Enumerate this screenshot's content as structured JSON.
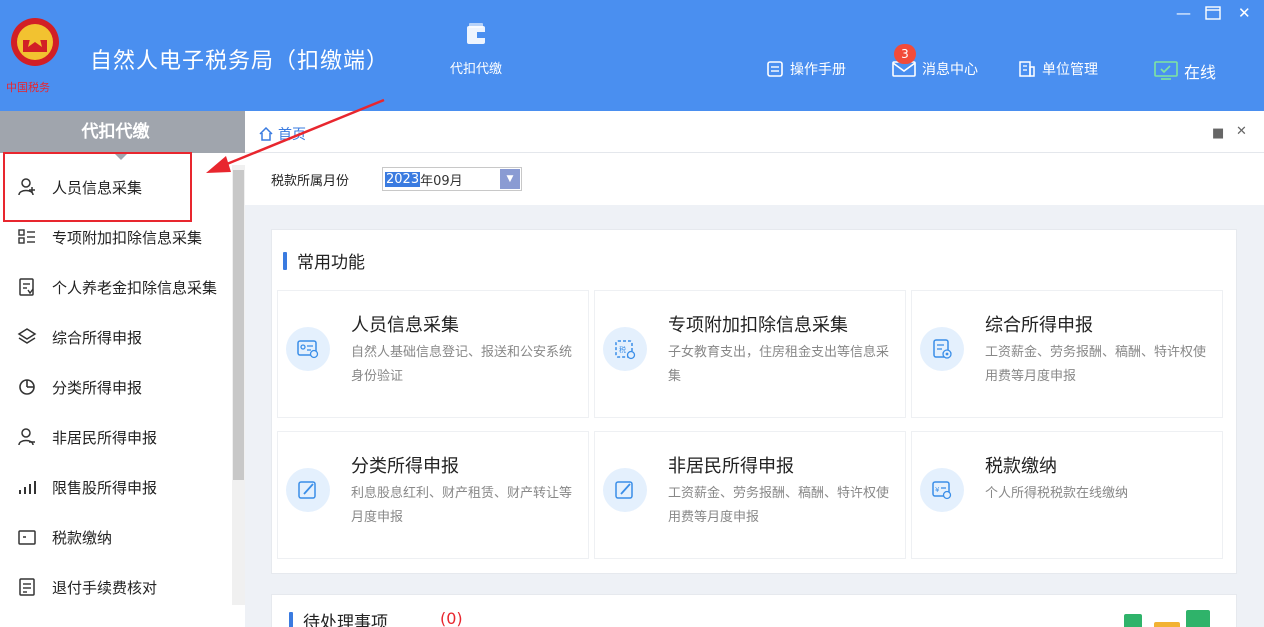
{
  "header": {
    "title": "自然人电子税务局（扣缴端）",
    "nav_tab": "代扣代缴",
    "manual": "操作手册",
    "messages": "消息中心",
    "message_count": "3",
    "unit_mgmt": "单位管理",
    "online": "在线"
  },
  "sidebar": {
    "title": "代扣代缴",
    "items": [
      {
        "label": "人员信息采集",
        "icon": "person-icon"
      },
      {
        "label": "专项附加扣除信息采集",
        "icon": "list-icon"
      },
      {
        "label": "个人养老金扣除信息采集",
        "icon": "pension-icon"
      },
      {
        "label": "综合所得申报",
        "icon": "layers-icon"
      },
      {
        "label": "分类所得申报",
        "icon": "pie-icon"
      },
      {
        "label": "非居民所得申报",
        "icon": "user-outline-icon"
      },
      {
        "label": "限售股所得申报",
        "icon": "bar-chart-icon"
      },
      {
        "label": "税款缴纳",
        "icon": "folder-icon"
      },
      {
        "label": "退付手续费核对",
        "icon": "checklist-icon"
      }
    ]
  },
  "breadcrumb": {
    "home": "首页"
  },
  "filter": {
    "label": "税款所属月份",
    "year": "2023",
    "rest": "年09月"
  },
  "common": {
    "title": "常用功能",
    "cards": [
      {
        "title": "人员信息采集",
        "desc": "自然人基础信息登记、报送和公安系统身份验证",
        "icon": "id-card-icon"
      },
      {
        "title": "专项附加扣除信息采集",
        "desc": "子女教育支出，住房租金支出等信息采集",
        "icon": "tax-doc-icon"
      },
      {
        "title": "综合所得申报",
        "desc": "工资薪金、劳务报酬、稿酬、特许权使用费等月度申报",
        "icon": "report-icon"
      },
      {
        "title": "分类所得申报",
        "desc": "利息股息红利、财产租赁、财产转让等月度申报",
        "icon": "edit-icon"
      },
      {
        "title": "非居民所得申报",
        "desc": "工资薪金、劳务报酬、稿酬、特许权使用费等月度申报",
        "icon": "edit-icon"
      },
      {
        "title": "税款缴纳",
        "desc": "个人所得税税款在线缴纳",
        "icon": "payment-icon"
      }
    ]
  },
  "todo": {
    "title": "待处理事项",
    "count": "(0)"
  },
  "colors": {
    "header": "#4a8ff0",
    "accent": "#3a7be0",
    "highlight": "#e8262e"
  }
}
